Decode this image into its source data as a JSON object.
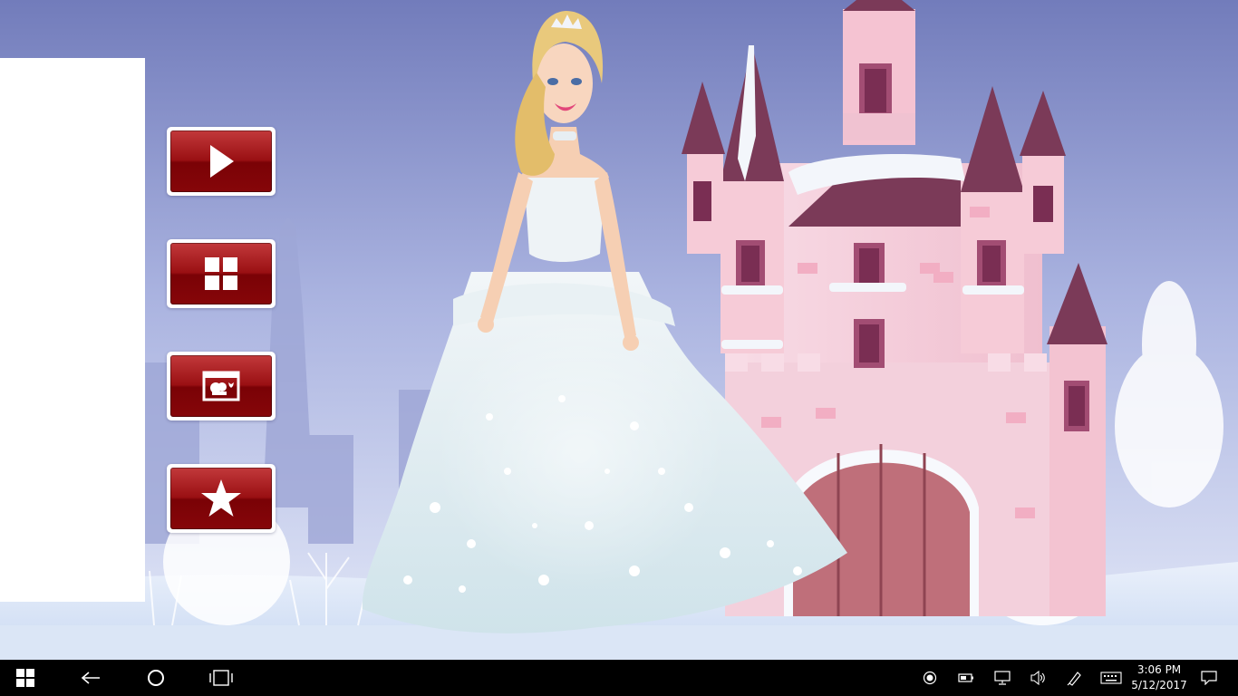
{
  "game": {
    "menu": [
      {
        "id": "play",
        "icon": "play-icon"
      },
      {
        "id": "grid",
        "icon": "grid-icon"
      },
      {
        "id": "gallery",
        "icon": "picture-icon"
      },
      {
        "id": "rate",
        "icon": "star-icon"
      }
    ],
    "colors": {
      "button_red": "#8a0a0d",
      "sky_top": "#7a83c0",
      "sky_bottom": "#dfe6f7",
      "castle_pink": "#f5c9d6",
      "roof_plum": "#86405f"
    }
  },
  "taskbar": {
    "icons": [
      "windows-start-icon",
      "back-arrow-icon",
      "cortana-circle-icon",
      "task-view-icon"
    ],
    "tray_icons": [
      "record-icon",
      "battery-icon",
      "network-icon",
      "volume-icon",
      "pen-icon",
      "keyboard-icon",
      "notification-icon"
    ],
    "time": "3:06 PM",
    "date": "5/12/2017"
  }
}
